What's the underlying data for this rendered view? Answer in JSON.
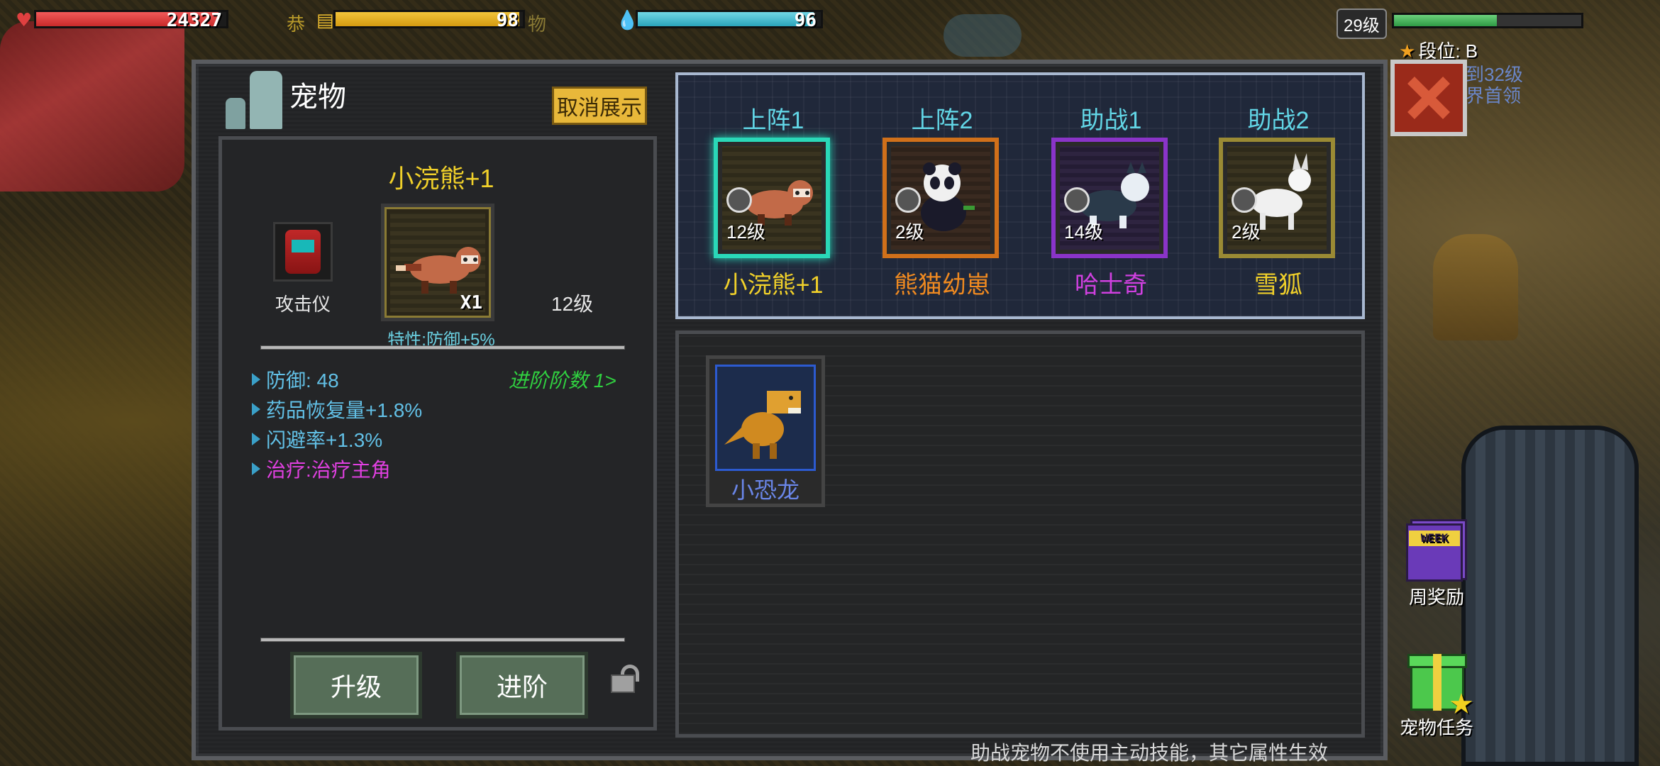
{
  "hud": {
    "hp": "24327",
    "food_label": "恭",
    "food": "98",
    "food_suffix": "物",
    "water": "96",
    "level": "29级",
    "rank": "段位: B",
    "side_hint_line1": "到32级",
    "side_hint_line2": "界首领"
  },
  "panel": {
    "title": "宠物",
    "cancel_display": "取消展示"
  },
  "detail": {
    "name": "小浣熊+1",
    "device_label": "攻击仪",
    "count": "X1",
    "level": "12级",
    "trait": "特性:防御+5%",
    "advance_count": "进阶阶数 1>",
    "stats": [
      {
        "text": "防御: 48",
        "color": "#62c0e6"
      },
      {
        "text": "药品恢复量+1.8%",
        "color": "#62c0e6"
      },
      {
        "text": "闪避率+1.3%",
        "color": "#62c0e6"
      },
      {
        "text": "治疗:治疗主角",
        "color": "#e040e0"
      }
    ],
    "upgrade_label": "升级",
    "advance_label": "进阶"
  },
  "team": [
    {
      "slot": "上阵1",
      "level": "12级",
      "name": "小浣熊+1",
      "name_color": "#f0d02a",
      "border": "#2ad8b8"
    },
    {
      "slot": "上阵2",
      "level": "2级",
      "name": "熊猫幼崽",
      "name_color": "#f08a20",
      "border": "#d0701a"
    },
    {
      "slot": "助战1",
      "level": "14级",
      "name": "哈士奇",
      "name_color": "#d040e0",
      "border": "#8a34c8"
    },
    {
      "slot": "助战2",
      "level": "2级",
      "name": "雪狐",
      "name_color": "#f0d02a",
      "border": "#9a8a34"
    }
  ],
  "storage": [
    {
      "name": "小恐龙"
    }
  ],
  "side_buttons": {
    "weekly": "周奖励",
    "weekly_badge": "WEEK",
    "pet_task": "宠物任务"
  },
  "footer": "助战宠物不使用主动技能，其它属性生效"
}
